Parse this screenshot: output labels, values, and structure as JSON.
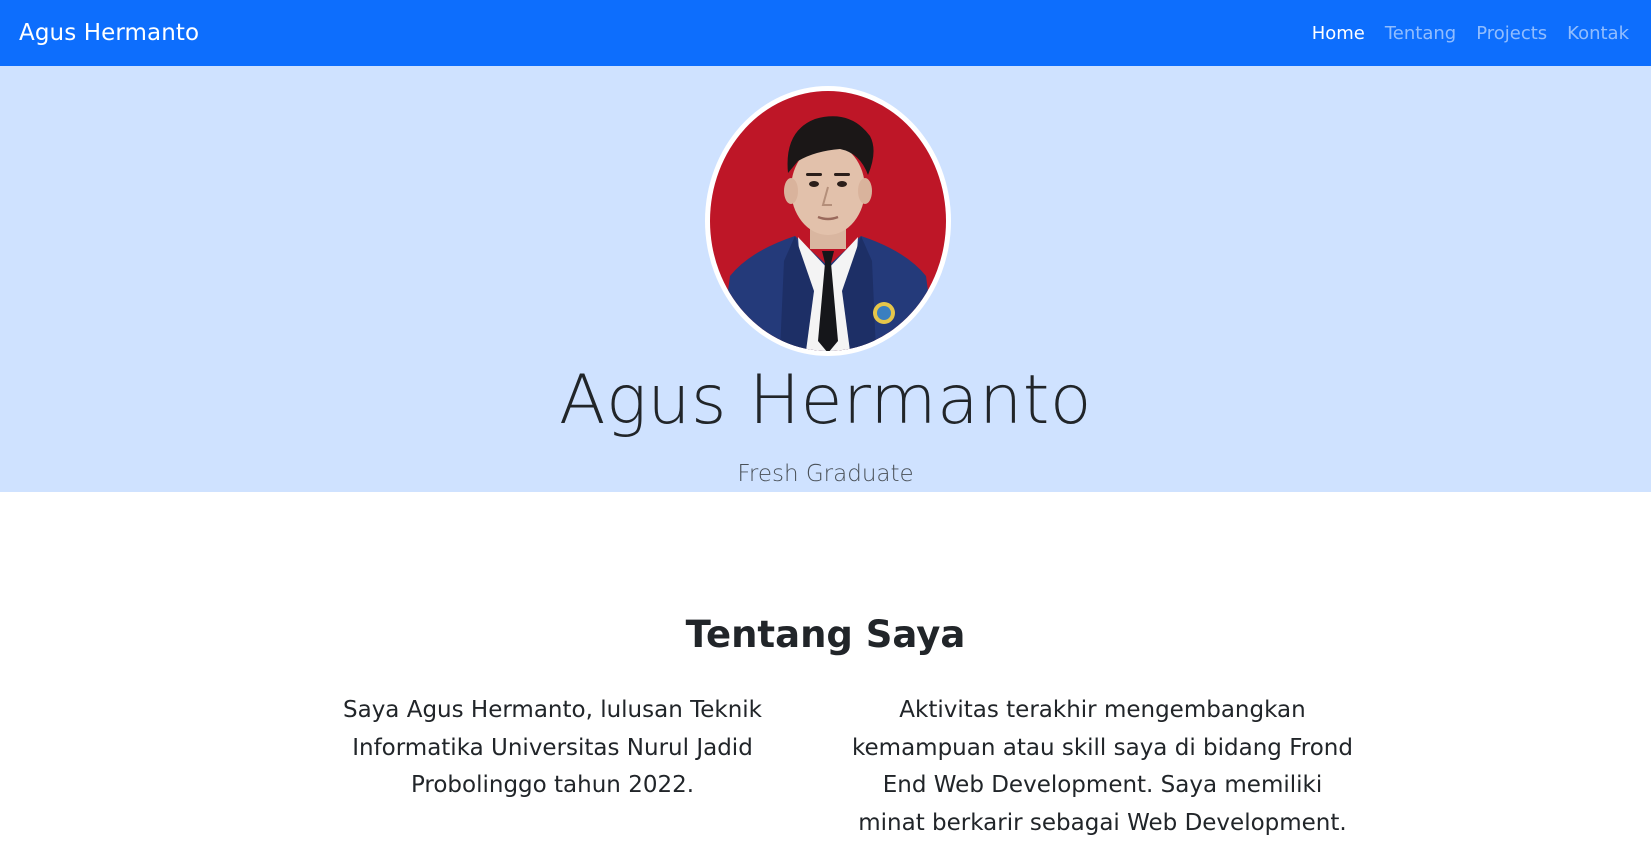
{
  "navbar": {
    "brand": "Agus Hermanto",
    "links": [
      {
        "label": "Home",
        "active": true
      },
      {
        "label": "Tentang",
        "active": false
      },
      {
        "label": "Projects",
        "active": false
      },
      {
        "label": "Kontak",
        "active": false
      }
    ]
  },
  "hero": {
    "name": "Agus Hermanto",
    "subtitle": "Fresh Graduate"
  },
  "about": {
    "title": "Tentang Saya",
    "left_text": "Saya Agus Hermanto, lulusan Teknik Informatika Universitas Nurul Jadid Probolinggo tahun 2022.",
    "right_text": "Aktivitas terakhir mengembangkan kemampuan atau skill saya di bidang Frond End Web Development. Saya memiliki minat berkarir sebagai Web Development."
  },
  "colors": {
    "navbar_bg": "#0d6efd",
    "hero_bg": "#cfe2ff",
    "photo_bg": "#be1627",
    "jacket": "#243a7a"
  }
}
